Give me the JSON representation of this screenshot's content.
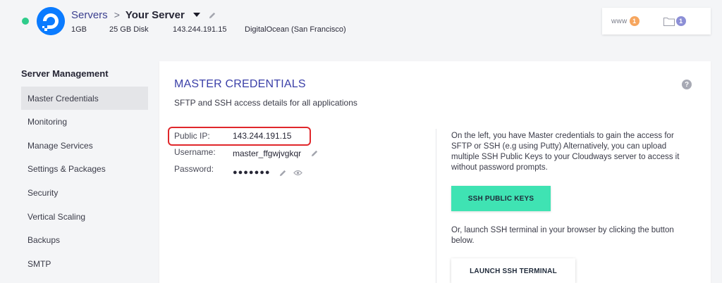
{
  "header": {
    "breadcrumb": {
      "root": "Servers",
      "separator": ">",
      "current": "Your Server"
    },
    "meta": {
      "ram": "1GB",
      "disk": "25 GB Disk",
      "ip": "143.244.191.15",
      "provider": "DigitalOcean (San Francisco)"
    },
    "badges": {
      "www_label": "www",
      "www_count": "1",
      "folder_count": "1"
    }
  },
  "sidebar": {
    "title": "Server Management",
    "items": [
      {
        "label": "Master Credentials"
      },
      {
        "label": "Monitoring"
      },
      {
        "label": "Manage Services"
      },
      {
        "label": "Settings & Packages"
      },
      {
        "label": "Security"
      },
      {
        "label": "Vertical Scaling"
      },
      {
        "label": "Backups"
      },
      {
        "label": "SMTP"
      }
    ]
  },
  "main": {
    "title": "MASTER CREDENTIALS",
    "help": "?",
    "subtitle": "SFTP and SSH access details for all applications",
    "credentials": {
      "public_ip_label": "Public IP:",
      "public_ip": "143.244.191.15",
      "username_label": "Username:",
      "username": "master_ffgwjvgkqr",
      "password_label": "Password:",
      "password_mask": "●●●●●●●"
    },
    "info_text": "On the left, you have Master credentials to gain the access for SFTP or SSH (e.g using Putty) Alternatively, you can upload multiple SSH Public Keys to your Cloudways server to access it without password prompts.",
    "ssh_keys_button": "SSH PUBLIC KEYS",
    "terminal_text": "Or, launch SSH terminal in your browser by clicking the button below.",
    "terminal_button": "LAUNCH SSH TERMINAL"
  },
  "colors": {
    "accent": "#3b40a8",
    "status_online": "#2fcc8b",
    "primary_button": "#3fe3b3",
    "highlight": "#e0272b"
  }
}
